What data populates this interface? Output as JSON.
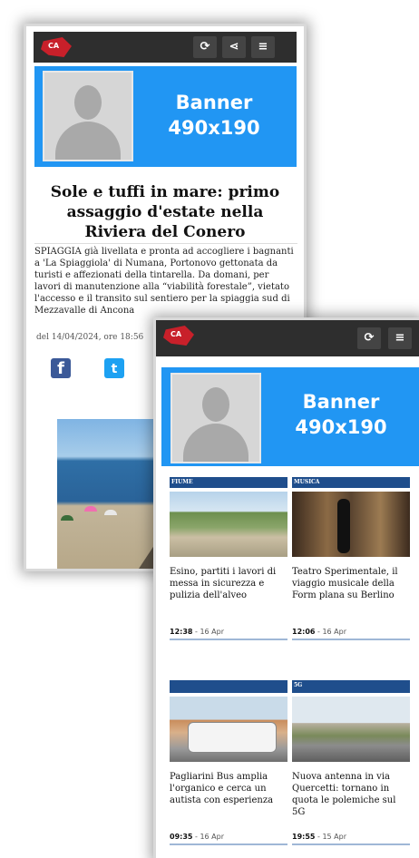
{
  "brand": {
    "logo_text": "CA",
    "accent": "#c8202a",
    "topbar": "#2e2e2e",
    "banner_bg": "#2196f3"
  },
  "toolbar": {
    "refresh_icon": "refresh-icon",
    "share_icon": "share-icon",
    "menu_icon": "menu-icon",
    "refresh_glyph": "⟳",
    "share_glyph": "⋖",
    "menu_glyph": "≡"
  },
  "banner": {
    "line1": "Banner",
    "line2": "490x190"
  },
  "article": {
    "title": "Sole e tuffi in mare: primo assaggio d'estate nella Riviera del Conero",
    "lede": "SPIAGGIA già livellata e pronta ad accogliere i bagnanti a 'La Spiaggiola' di Numana, Portonovo gettonata da turisti e affezionati della tintarella. Da domani, per lavori di manutenzione alla “viabilità forestale”, vietato l'accesso e il transito sul sentiero per la spiaggia sud di Mezzavalle di Ancona",
    "meta": "del 14/04/2024, ore 18:56",
    "share": {
      "facebook": "f",
      "twitter": "t"
    }
  },
  "cards": [
    {
      "tag": "FIUME",
      "headline": "Esino, partiti i lavori di messa in sicurezza e pulizia dell'alveo",
      "time": "12:38",
      "date": " - 16 Apr"
    },
    {
      "tag": "MUSICA",
      "headline": "Teatro Sperimentale, il viaggio musicale della Form plana su Berlino",
      "time": "12:06",
      "date": " - 16 Apr"
    },
    {
      "tag": "",
      "headline": "Pagliarini Bus amplia l'organico e cerca un autista con esperienza",
      "time": "09:35",
      "date": " - 16 Apr"
    },
    {
      "tag": "5G",
      "headline": "Nuova antenna in via Quercetti: tornano in quota le polemiche sul 5G",
      "time": "19:55",
      "date": " - 15 Apr"
    }
  ]
}
